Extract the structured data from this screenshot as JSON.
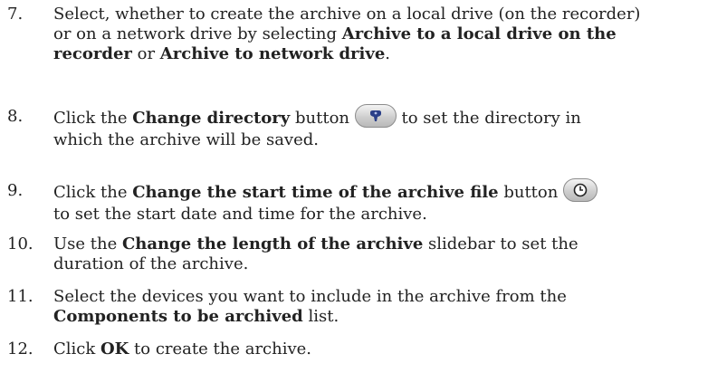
{
  "steps": [
    {
      "number": "7.",
      "line1": "Select, whether to create the archive on a local drive (on the recorder)",
      "line2_pre": "or on a network drive by selecting ",
      "line2_bold": "Archive to a local drive on the",
      "line3_bold1": "recorder",
      "line3_mid": " or ",
      "line3_bold2": "Archive to network drive",
      "line3_end": "."
    },
    {
      "number": "8.",
      "pre": "Click the ",
      "bold": "Change directory",
      "post": " button ",
      "icon": "change-directory-icon",
      "after_icon": "  to set the directory in",
      "line2": "which the archive will be saved."
    },
    {
      "number": "9.",
      "pre": "Click the ",
      "bold": "Change the start time of the archive file",
      "post": " button ",
      "icon": "clock-icon",
      "line2": "to set the start date and time for the archive."
    },
    {
      "number": "10.",
      "pre": "Use the ",
      "bold": "Change the length of the archive",
      "post": " slidebar to set the",
      "line2": "duration of the archive."
    },
    {
      "number": "11.",
      "line1": "Select the devices you want to include in the archive from the",
      "bold": "Components to be archived",
      "post": " list."
    },
    {
      "number": "12.",
      "pre": "Click ",
      "bold": "OK",
      "post": " to create the archive."
    }
  ]
}
